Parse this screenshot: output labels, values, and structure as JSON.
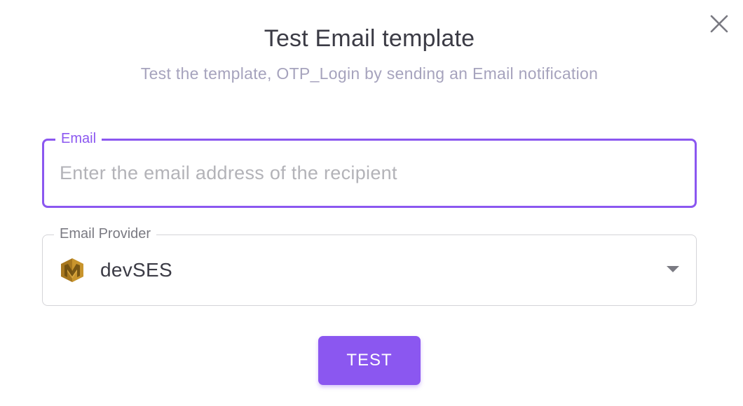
{
  "dialog": {
    "title": "Test Email template",
    "subtitle": "Test the template, OTP_Login by sending an Email notification",
    "close_icon": "close-icon"
  },
  "email_field": {
    "label": "Email",
    "value": "",
    "placeholder": "Enter the email address of the recipient"
  },
  "provider_field": {
    "label": "Email Provider",
    "selected_value": "devSES",
    "icon": "aws-ses-icon",
    "dropdown_icon": "caret-down-icon"
  },
  "actions": {
    "test_label": "TEST"
  },
  "colors": {
    "accent": "#8b57f0",
    "title": "#3b3b45",
    "subtitle": "#a6a3bd",
    "border": "#d4d4d8",
    "ses_gold": "#c9952d"
  }
}
